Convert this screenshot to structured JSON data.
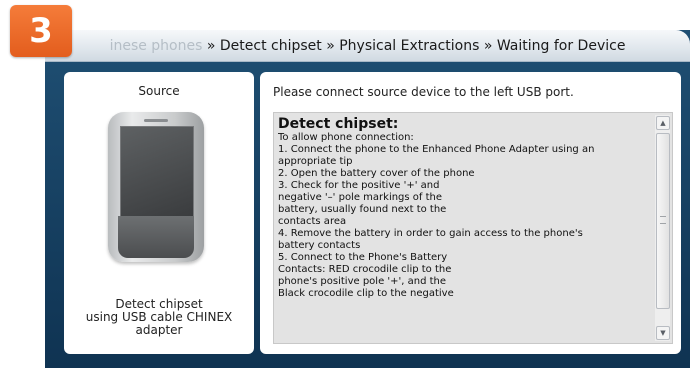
{
  "step": {
    "number": "3"
  },
  "breadcrumb": {
    "faded_start": "inese phones",
    "rest": " » Detect chipset » Physical Extractions » Waiting for Device"
  },
  "source": {
    "title": "Source",
    "caption": [
      "Detect  chipset",
      "using USB cable CHINEX",
      "adapter"
    ],
    "image": "feature-phone-image"
  },
  "main": {
    "instruction": "Please connect source device to the left USB port.",
    "heading": "Detect chipset:",
    "lines": [
      "To allow phone connection:",
      "1. Connect the phone to the Enhanced Phone Adapter using an",
      "appropriate tip",
      "2. Open the battery cover of the phone",
      "3. Check for the positive '+' and",
      "negative '–' pole markings of the",
      "battery, usually found next to the",
      "contacts area",
      "4. Remove the battery in order to gain access to the phone's",
      "battery contacts",
      "5. Connect to the Phone's Battery",
      "Contacts: RED crocodile clip to the",
      "phone's positive pole '+', and the",
      "Black crocodile clip to the negative"
    ]
  },
  "colors": {
    "badge": "#e86a2a",
    "frame": "#1a4466",
    "info_box": "#e3e3e3"
  }
}
